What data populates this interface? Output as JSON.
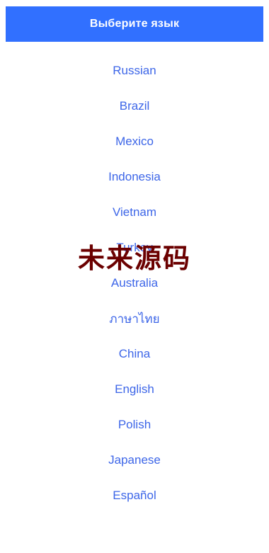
{
  "header": {
    "title": "Выберите язык",
    "background_color": "#3170ff",
    "text_color": "#ffffff"
  },
  "languages": [
    {
      "label": "Russian"
    },
    {
      "label": "Brazil"
    },
    {
      "label": "Mexico"
    },
    {
      "label": "Indonesia"
    },
    {
      "label": "Vietnam"
    },
    {
      "label": "Turkey"
    },
    {
      "label": "Australia"
    },
    {
      "label": "ภาษาไทย"
    },
    {
      "label": "China"
    },
    {
      "label": "English"
    },
    {
      "label": "Polish"
    },
    {
      "label": "Japanese"
    },
    {
      "label": "Español"
    }
  ],
  "link_color": "#3d66e8",
  "watermark": {
    "text": "未来源码",
    "color": "#6b0000"
  }
}
